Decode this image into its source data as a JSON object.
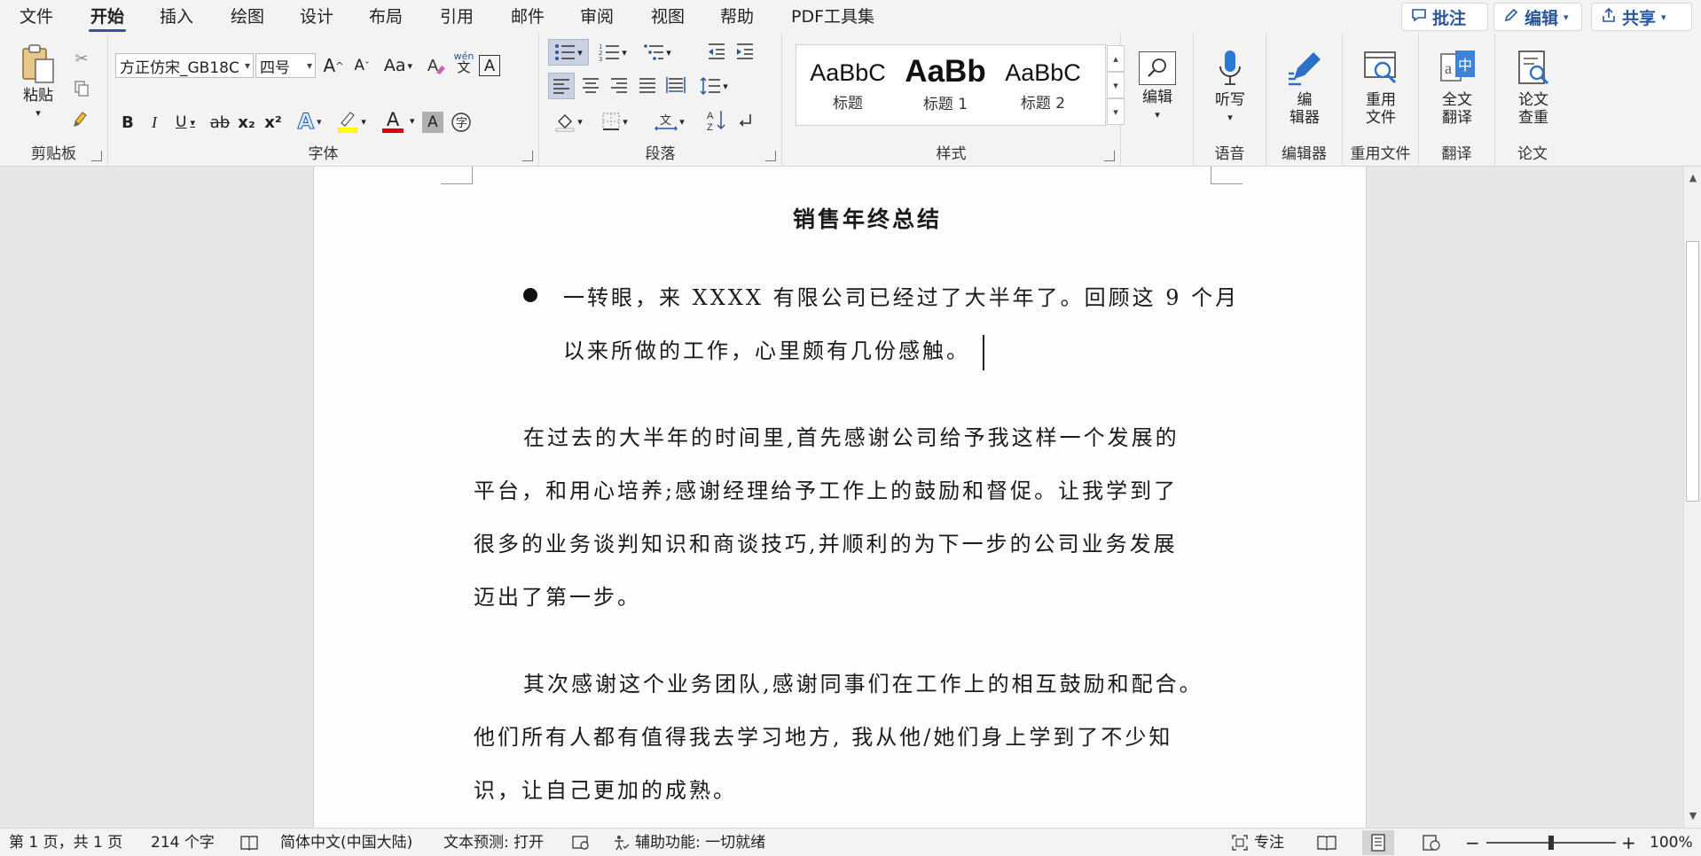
{
  "tabs": [
    "文件",
    "开始",
    "插入",
    "绘图",
    "设计",
    "布局",
    "引用",
    "邮件",
    "审阅",
    "视图",
    "帮助",
    "PDF工具集"
  ],
  "active_tab": "开始",
  "topbar": {
    "comment_label": "批注",
    "edit_label": "编辑",
    "share_label": "共享"
  },
  "ribbon": {
    "clipboard": {
      "paste_label": "粘贴",
      "group_label": "剪贴板"
    },
    "font": {
      "font_name": "方正仿宋_GB18C",
      "font_size": "四号",
      "grow": "A",
      "shrink": "A",
      "case": "Aa",
      "phonetic_top": "wén",
      "phonetic_bottom": "文",
      "border_char": "A",
      "bold": "B",
      "italic": "I",
      "underline": "U",
      "strike": "ab",
      "subscript": "x₂",
      "superscript": "x²",
      "effect": "A",
      "color_a": "A",
      "shade_a": "A",
      "group_label": "字体"
    },
    "paragraph": {
      "group_label": "段落"
    },
    "styles": {
      "items": [
        {
          "sample": "AaBbC",
          "name": "标题"
        },
        {
          "sample": "AaBb",
          "name": "标题 1"
        },
        {
          "sample": "AaBbC",
          "name": "标题 2"
        }
      ],
      "group_label": "样式"
    },
    "editing": {
      "label": "编辑"
    },
    "voice": {
      "dictate_label": "听写",
      "group_label": "语音"
    },
    "editor": {
      "label_line1": "编",
      "label_line2": "辑器",
      "group_label": "编辑器"
    },
    "reuse": {
      "label_line1": "重用",
      "label_line2": "文件",
      "group_label": "重用文件"
    },
    "translate": {
      "label_line1": "全文",
      "label_line2": "翻译",
      "group_label": "翻译"
    },
    "paper": {
      "label_line1": "论文",
      "label_line2": "查重",
      "group_label": "论文"
    }
  },
  "document": {
    "title": "销售年终总结",
    "bullet_lines": [
      "一转眼，来 XXXX 有限公司已经过了大半年了。回顾这 9 个月",
      "以来所做的工作，心里颇有几份感触。"
    ],
    "para1": [
      "在过去的大半年的时间里,首先感谢公司给予我这样一个发展的",
      "平台，和用心培养;感谢经理给予工作上的鼓励和督促。让我学到了",
      "很多的业务谈判知识和商谈技巧,并顺利的为下一步的公司业务发展",
      "迈出了第一步。"
    ],
    "para2": [
      "其次感谢这个业务团队,感谢同事们在工作上的相互鼓励和配合。",
      "他们所有人都有值得我去学习地方, 我从他/她们身上学到了不少知",
      "识，让自己更加的成熟。"
    ]
  },
  "statusbar": {
    "page_info": "第 1 页，共 1 页",
    "word_count": "214 个字",
    "language": "简体中文(中国大陆)",
    "text_prediction": "文本预测: 打开",
    "accessibility": "辅助功能: 一切就绪",
    "focus": "专注",
    "zoom": "100%",
    "zoom_minus": "−",
    "zoom_plus": "+",
    "zoom_percent": 100
  },
  "colors": {
    "accent": "#2b579a",
    "highlight": "#ffff00",
    "font_color": "#e00000"
  }
}
